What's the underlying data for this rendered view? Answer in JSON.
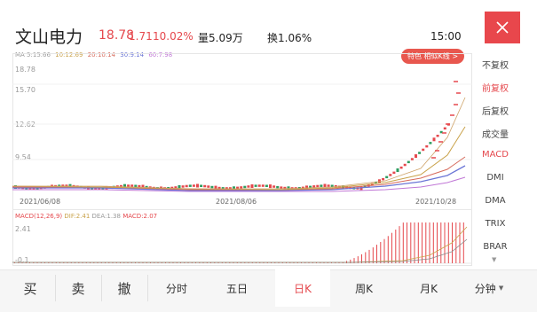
{
  "header": {
    "name": "文山电力",
    "price": "18.78",
    "change": "1.71",
    "change_pct": "10.02%",
    "volume": "量5.09万",
    "turnover": "换1.06%",
    "time": "15:00"
  },
  "ma_line": {
    "ma5": "MA 5:15.66",
    "ma10": "10:12.69",
    "ma20": "20:10.14",
    "ma30": "30:9.14",
    "ma60": "60:7.98"
  },
  "special_button": "特色 相似K线 >",
  "price_axis": [
    "18.78",
    "15.70",
    "12.62",
    "9.54"
  ],
  "date_axis": [
    "2021/06/08",
    "2021/08/06",
    "2021/10/28"
  ],
  "macd": {
    "label": "MACD(12,26,9)",
    "dif": "DIF:2.41",
    "dea": "DEA:1.38",
    "macd": "MACD:2.07",
    "axis_top": "2.41",
    "axis_bottom": "-0.1"
  },
  "side_menu": [
    "不复权",
    "前复权",
    "后复权",
    "成交量",
    "MACD",
    "DMI",
    "DMA",
    "TRIX",
    "BRAR"
  ],
  "side_active": [
    "前复权",
    "MACD"
  ],
  "bottom_actions": [
    "买",
    "卖",
    "撤"
  ],
  "bottom_tabs": [
    "分时",
    "五日",
    "日K",
    "周K",
    "月K",
    "分钟"
  ],
  "active_tab": "日K",
  "colors": {
    "up": "#e5484d",
    "down": "#2e9c5f",
    "ma5": "#cfa46a",
    "ma10": "#c9a24a",
    "ma20": "#d66a5b",
    "ma30": "#6b76d6",
    "ma60": "#c077d6"
  }
}
